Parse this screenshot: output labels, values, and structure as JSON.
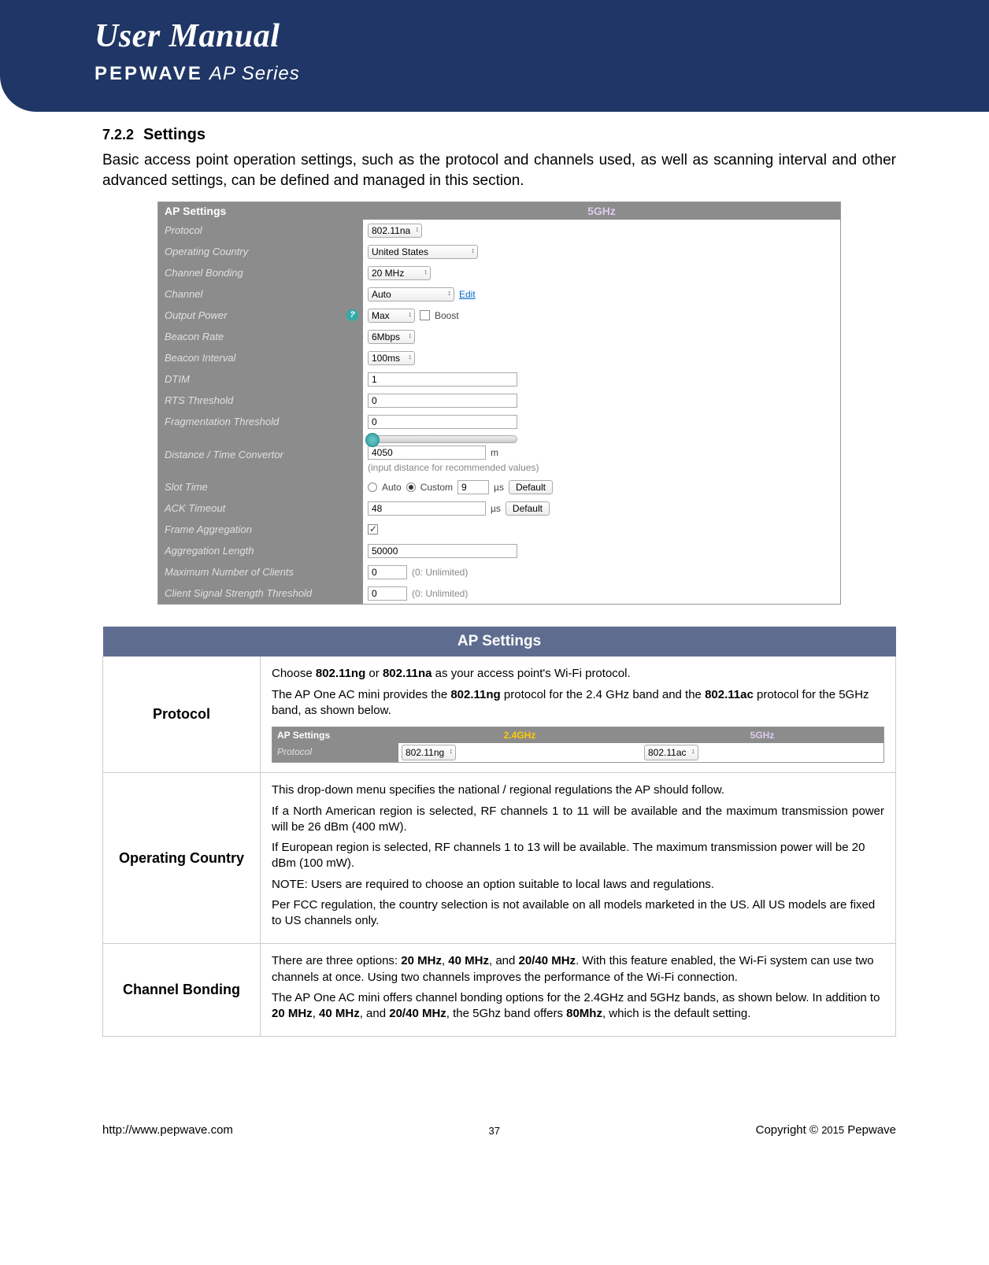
{
  "header": {
    "title": "User Manual",
    "brand_a": "PEPWAVE",
    "brand_b": "AP Series"
  },
  "section": {
    "number": "7.2.2",
    "title": "Settings"
  },
  "intro": "Basic access point operation settings, such as the protocol and channels used, as well as scanning interval and other advanced settings, can be defined and managed in this section.",
  "shot": {
    "hdr_left": "AP Settings",
    "hdr_right": "5GHz",
    "protocol": {
      "label": "Protocol",
      "value": "802.11na"
    },
    "country": {
      "label": "Operating Country",
      "value": "United States"
    },
    "bonding": {
      "label": "Channel Bonding",
      "value": "20 MHz"
    },
    "channel": {
      "label": "Channel",
      "value": "Auto",
      "edit": "Edit"
    },
    "power": {
      "label": "Output Power",
      "value": "Max",
      "boost": "Boost"
    },
    "beacon_rate": {
      "label": "Beacon Rate",
      "value": "6Mbps"
    },
    "beacon_interval": {
      "label": "Beacon Interval",
      "value": "100ms"
    },
    "dtim": {
      "label": "DTIM",
      "value": "1"
    },
    "rts": {
      "label": "RTS Threshold",
      "value": "0"
    },
    "frag": {
      "label": "Fragmentation Threshold",
      "value": "0"
    },
    "dist": {
      "label": "Distance / Time Convertor",
      "value": "4050",
      "unit": "m",
      "hint": "(input distance for recommended values)"
    },
    "slot": {
      "label": "Slot Time",
      "opt_auto": "Auto",
      "opt_custom": "Custom",
      "value": "9",
      "unit": "µs",
      "btn": "Default"
    },
    "ack": {
      "label": "ACK Timeout",
      "value": "48",
      "unit": "µs",
      "btn": "Default"
    },
    "aggr": {
      "label": "Frame Aggregation"
    },
    "aggr_len": {
      "label": "Aggregation Length",
      "value": "50000"
    },
    "max_clients": {
      "label": "Maximum Number of Clients",
      "value": "0",
      "hint": "(0: Unlimited)"
    },
    "sig_thresh": {
      "label": "Client Signal Strength Threshold",
      "value": "0",
      "hint": "(0: Unlimited)"
    }
  },
  "desc_title": "AP Settings",
  "proto": {
    "key": "Protocol",
    "p1a": "Choose ",
    "p1b": "802.11ng",
    "p1c": " or ",
    "p1d": "802.11na",
    "p1e": " as your access point's Wi-Fi protocol.",
    "p2a": "The AP One AC mini provides the ",
    "p2b": "802.11ng",
    "p2c": " protocol for the 2.4 GHz band and the ",
    "p2d": "802.11ac",
    "p2e": " protocol for the 5GHz band, as shown below.",
    "mini": {
      "hdr_left": "AP Settings",
      "hdr_24": "2.4GHz",
      "hdr_5": "5GHz",
      "row_label": "Protocol",
      "val24": "802.11ng",
      "val5": "802.11ac"
    }
  },
  "opcountry": {
    "key": "Operating Country",
    "p1": "This drop-down menu specifies the national / regional regulations the AP should follow.",
    "p2": "If a North American region is selected, RF channels 1 to 11 will be available and the maximum transmission power will be 26 dBm (400 mW).",
    "p3": "If European region is selected, RF channels 1 to 13 will be available. The maximum transmission power will be 20 dBm (100 mW).",
    "p4": "NOTE: Users are required to choose an option suitable to local laws and regulations.",
    "p5": "Per FCC regulation, the country selection is not available on all models marketed in the US. All US models are fixed to US channels only."
  },
  "chbond": {
    "key": "Channel Bonding",
    "p1a": "There are three options: ",
    "p1b": "20 MHz",
    "p1c": ", ",
    "p1d": "40 MHz",
    "p1e": ", and ",
    "p1f": "20/40 MHz",
    "p1g": ". With this feature enabled, the Wi-Fi system can use two channels at once. Using two channels improves the performance of the Wi-Fi connection.",
    "p2a": "The AP One AC mini offers channel bonding options for the 2.4GHz and 5GHz bands, as shown below. In addition to ",
    "p2b": "20 MHz",
    "p2c": ", ",
    "p2d": "40 MHz",
    "p2e": ", and ",
    "p2f": "20/40 MHz",
    "p2g": ", the 5Ghz band offers ",
    "p2h": "80Mhz",
    "p2i": ", which is the default setting."
  },
  "footer": {
    "url": "http://www.pepwave.com",
    "page": "37",
    "copyright_a": "Copyright © ",
    "year": "2015",
    "copyright_b": " Pepwave"
  }
}
